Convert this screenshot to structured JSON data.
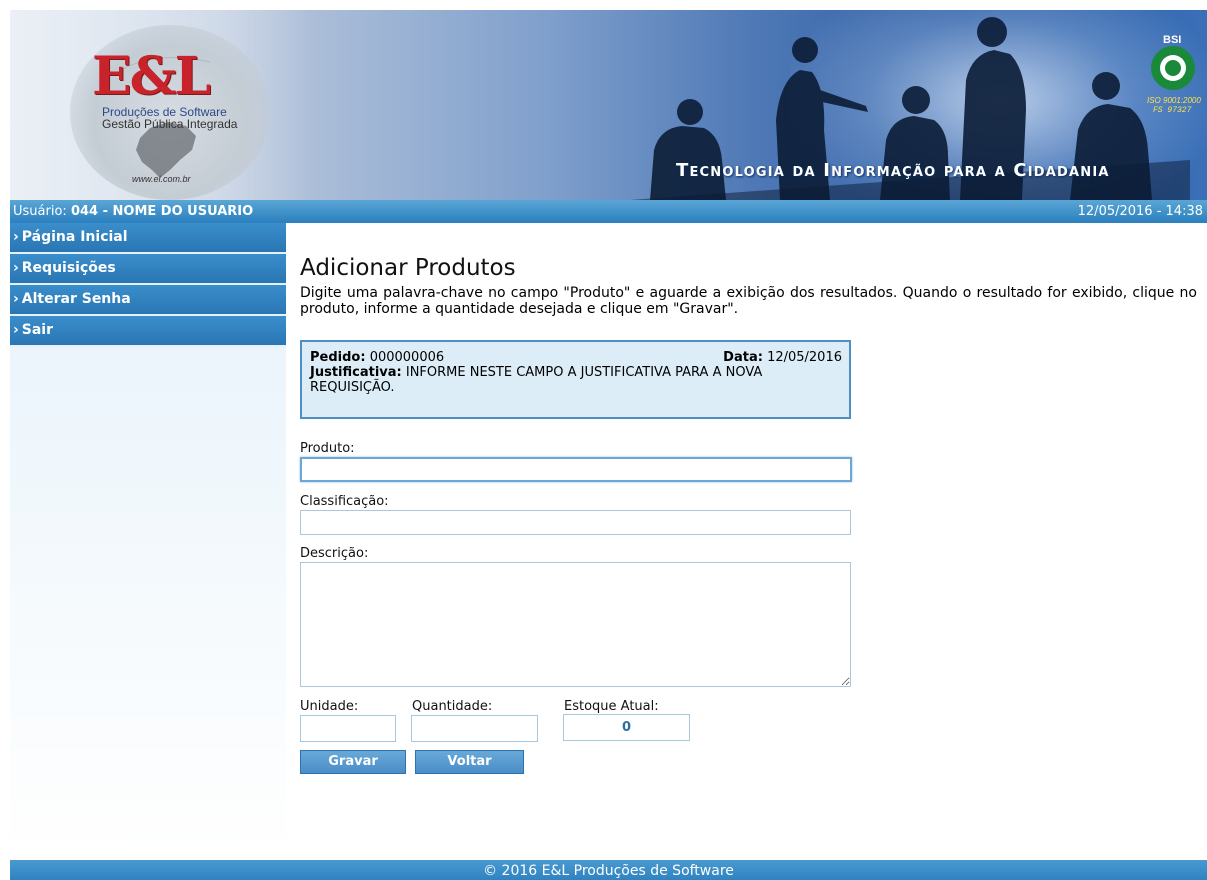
{
  "header": {
    "logo_text": "E&L",
    "logo_subtitle_1": "Produções de Software",
    "logo_subtitle_2": "Gestão Pública Integrada",
    "logo_url": "www.el.com.br",
    "iso_bsi": "BSI",
    "iso_line1": "ISO 9001:2000",
    "iso_line2": "FS 97327",
    "tagline": "Tecnologia da Informação para a Cidadania"
  },
  "userbar": {
    "user_label": "Usuário:",
    "user_value": "044 - NOME DO USUARIO",
    "datetime": "12/05/2016 - 14:38"
  },
  "sidebar": {
    "items": [
      {
        "label": "Página Inicial"
      },
      {
        "label": "Requisições"
      },
      {
        "label": "Alterar Senha"
      },
      {
        "label": "Sair"
      }
    ]
  },
  "main": {
    "title": "Adicionar Produtos",
    "description": "Digite uma palavra-chave no campo \"Produto\" e aguarde a exibição dos resultados. Quando o resultado for exibido, clique no produto, informe a quantidade desejada e clique em \"Gravar\".",
    "order": {
      "pedido_label": "Pedido:",
      "pedido_value": "000000006",
      "data_label": "Data:",
      "data_value": "12/05/2016",
      "justificativa_label": "Justificativa:",
      "justificativa_value": "INFORME NESTE CAMPO A JUSTIFICATIVA PARA A NOVA REQUISIÇÃO."
    },
    "fields": {
      "produto_label": "Produto:",
      "produto_value": "",
      "classificacao_label": "Classificação:",
      "classificacao_value": "",
      "descricao_label": "Descrição:",
      "descricao_value": "",
      "unidade_label": "Unidade:",
      "unidade_value": "",
      "quantidade_label": "Quantidade:",
      "quantidade_value": "",
      "estoque_label": "Estoque Atual:",
      "estoque_value": "0"
    },
    "buttons": {
      "gravar": "Gravar",
      "voltar": "Voltar"
    }
  },
  "footer": {
    "text": "© 2016 E&L Produções de Software"
  }
}
